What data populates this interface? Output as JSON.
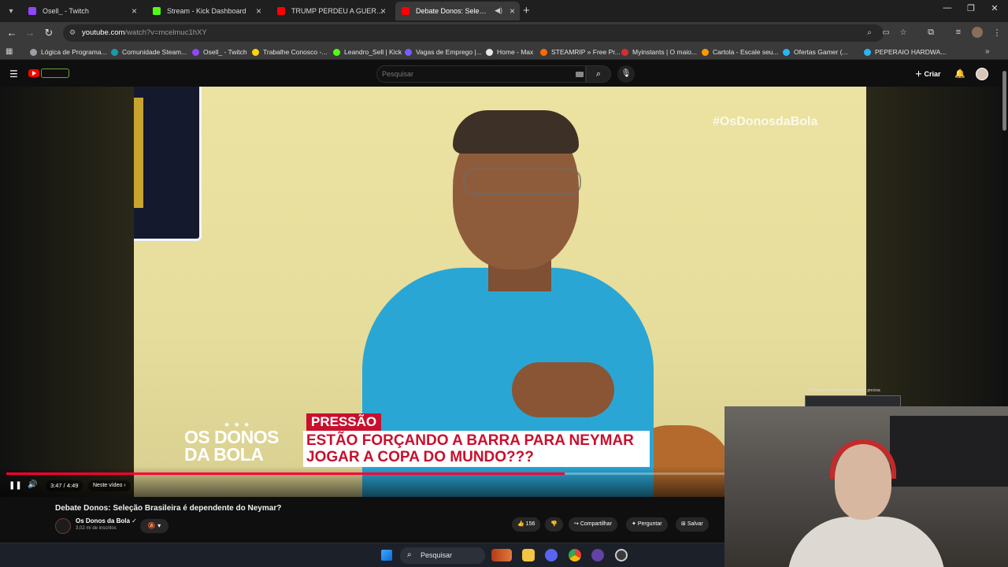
{
  "browser": {
    "tabs": [
      {
        "label": "Osell_ - Twitch",
        "favicon_color": "#9146ff",
        "active": false
      },
      {
        "label": "Stream - Kick Dashboard",
        "favicon_color": "#53fc18",
        "active": false
      },
      {
        "label": "TRUMP PERDEU A GUERRA??",
        "favicon_color": "#ff0000",
        "active": false
      },
      {
        "label": "Debate Donos: Seleção Brasileira",
        "favicon_color": "#ff0000",
        "active": true
      }
    ],
    "url": {
      "host": "youtube.com",
      "path": "/watch?v=mcelmuc1hXY"
    },
    "bookmarks": [
      {
        "label": "Lógica de Programa...",
        "icon_color": "#9aa0a6"
      },
      {
        "label": "Comunidade Steam...",
        "icon_color": "#1b9aaa"
      },
      {
        "label": "Osell_ - Twitch",
        "icon_color": "#9146ff"
      },
      {
        "label": "Trabalhe Conosco -...",
        "icon_color": "#ffd400"
      },
      {
        "label": "Leandro_Sell | Kick",
        "icon_color": "#53fc18"
      },
      {
        "label": "Vagas de Emprego |...",
        "icon_color": "#7b5cff"
      },
      {
        "label": "Home - Max",
        "icon_color": "#e8e8e8"
      },
      {
        "label": "STEAMRIP » Free Pr...",
        "icon_color": "#ff6a00"
      },
      {
        "label": "Myinstants | O maio...",
        "icon_color": "#d32f2f"
      },
      {
        "label": "Cartola - Escale seu...",
        "icon_color": "#ff9800"
      },
      {
        "label": "Ofertas Gamer (...",
        "icon_color": "#29b6f6"
      },
      {
        "label": "PEPERAIO HARDWA...",
        "icon_color": "#29b6f6"
      }
    ]
  },
  "youtube": {
    "search_placeholder": "Pesquisar",
    "create_label": "Criar"
  },
  "video": {
    "hashtag": "#OsDonosdaBola",
    "logo_line1": "OS DONOS",
    "logo_line2": "DA BOLA",
    "banner_tag": "PRESSÃO",
    "banner_line1": "ESTÃO FORÇANDO A BARRA PARA NEYMAR",
    "banner_line2": "JOGAR A COPA DO MUNDO???",
    "time": "3:47 / 4:49",
    "chapter": "Neste vídeo ›",
    "progress_fraction": 0.777,
    "pip_label": "Pulse para cima para uma busca precisa"
  },
  "details": {
    "title": "Debate Donos: Seleção Brasileira é dependente do Neymar?",
    "channel": "Os Donos da Bola",
    "subscribers": "3,02 mi de inscritos",
    "likes": "156",
    "share": "Compartilhar",
    "ask": "Perguntar",
    "save": "Salvar"
  },
  "taskbar": {
    "search_label": "Pesquisar",
    "apps": [
      {
        "name": "folder-icon",
        "color": "#f4c542"
      },
      {
        "name": "discord-icon",
        "color": "#5865f2"
      },
      {
        "name": "chrome-icon",
        "color": "#e94235"
      },
      {
        "name": "twitch-icon",
        "color": "#6441a5"
      },
      {
        "name": "obs-icon",
        "color": "#3a3a3a"
      }
    ]
  }
}
